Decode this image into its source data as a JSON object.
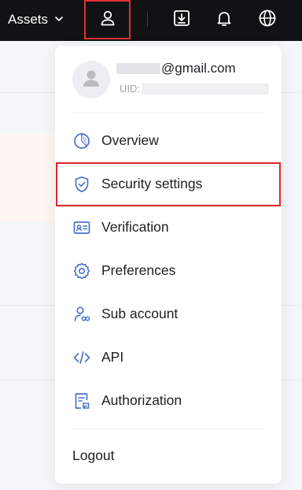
{
  "topbar": {
    "assets_label": "Assets",
    "icons": [
      "chevron-down-icon",
      "user-icon",
      "download-icon",
      "bell-icon",
      "globe-icon"
    ]
  },
  "profile": {
    "email_suffix": "@gmail.com",
    "uid_label": "UID:"
  },
  "menu": {
    "items": [
      {
        "label": "Overview",
        "icon": "pie-chart-icon"
      },
      {
        "label": "Security settings",
        "icon": "shield-check-icon"
      },
      {
        "label": "Verification",
        "icon": "id-card-icon"
      },
      {
        "label": "Preferences",
        "icon": "gear-icon"
      },
      {
        "label": "Sub account",
        "icon": "sub-account-icon"
      },
      {
        "label": "API",
        "icon": "code-icon"
      },
      {
        "label": "Authorization",
        "icon": "document-icon"
      }
    ],
    "logout_label": "Logout"
  },
  "colors": {
    "topbar_bg": "#111214",
    "icon_accent": "#4a72c9",
    "highlight_border": "#d9252c"
  }
}
